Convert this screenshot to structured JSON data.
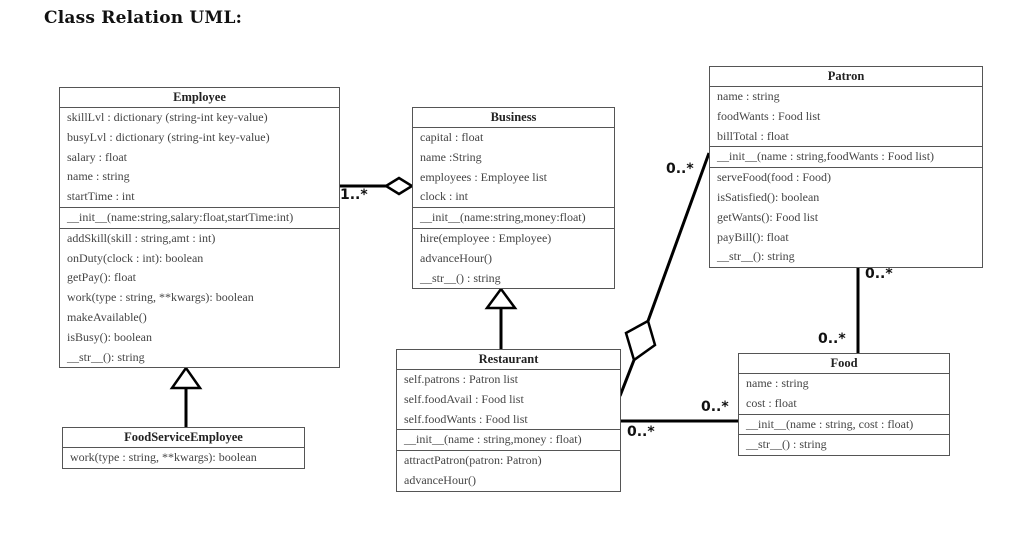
{
  "title": "Class Relation UML:",
  "classes": {
    "employee": {
      "name": "Employee",
      "attributes": [
        "skillLvl : dictionary (string-int key-value)",
        "busyLvl : dictionary (string-int key-value)",
        "salary : float",
        "name : string",
        "startTime : int"
      ],
      "constructor": [
        "__init__(name:string,salary:float,startTime:int)"
      ],
      "methods": [
        "addSkill(skill : string,amt : int)",
        "onDuty(clock : int): boolean",
        "getPay(): float",
        "work(type : string, **kwargs): boolean",
        "makeAvailable()",
        "isBusy(): boolean",
        "__str__(): string"
      ]
    },
    "food_service_employee": {
      "name": "FoodServiceEmployee",
      "methods": [
        "work(type : string, **kwargs): boolean"
      ]
    },
    "business": {
      "name": "Business",
      "attributes": [
        "capital : float",
        "name :String",
        "employees : Employee list",
        "clock : int"
      ],
      "constructor": [
        "__init__(name:string,money:float)"
      ],
      "methods": [
        "hire(employee : Employee)",
        "advanceHour()",
        "__str__() : string"
      ]
    },
    "restaurant": {
      "name": "Restaurant",
      "attributes": [
        "self.patrons : Patron list",
        "self.foodAvail : Food list",
        "self.foodWants : Food list"
      ],
      "constructor": [
        "__init__(name : string,money : float)"
      ],
      "methods": [
        "attractPatron(patron: Patron)",
        "advanceHour()"
      ]
    },
    "patron": {
      "name": "Patron",
      "attributes": [
        "name : string",
        "foodWants : Food list",
        "billTotal : float"
      ],
      "constructor": [
        "__init__(name : string,foodWants : Food list)"
      ],
      "methods": [
        "serveFood(food : Food)",
        "isSatisfied(): boolean",
        "getWants(): Food list",
        "payBill(): float",
        "__str__(): string"
      ]
    },
    "food": {
      "name": "Food",
      "attributes": [
        "name : string",
        "cost : float"
      ],
      "constructor": [
        "__init__(name : string, cost : float)"
      ],
      "methods": [
        "__str__() : string"
      ]
    }
  },
  "relations": [
    {
      "type": "aggregation",
      "from": "Business",
      "to": "Employee",
      "multiplicity_to": "1..*"
    },
    {
      "type": "inheritance",
      "from": "FoodServiceEmployee",
      "to": "Employee"
    },
    {
      "type": "inheritance",
      "from": "Restaurant",
      "to": "Business"
    },
    {
      "type": "aggregation",
      "from": "Restaurant",
      "to": "Patron",
      "multiplicity_to": "0..*"
    },
    {
      "type": "association",
      "from": "Restaurant",
      "to": "Food",
      "multiplicity_from": "0..*",
      "multiplicity_to": "0..*"
    },
    {
      "type": "association",
      "from": "Patron",
      "to": "Food",
      "multiplicity_from": "0..*",
      "multiplicity_to": "0..*"
    }
  ],
  "multiplicities": {
    "business_employee": "1..*",
    "restaurant_patron": "0..*",
    "patron_food_top": "0..*",
    "patron_food_bottom": "0..*",
    "restaurant_food_left": "0..*",
    "restaurant_food_right": "0..*"
  }
}
